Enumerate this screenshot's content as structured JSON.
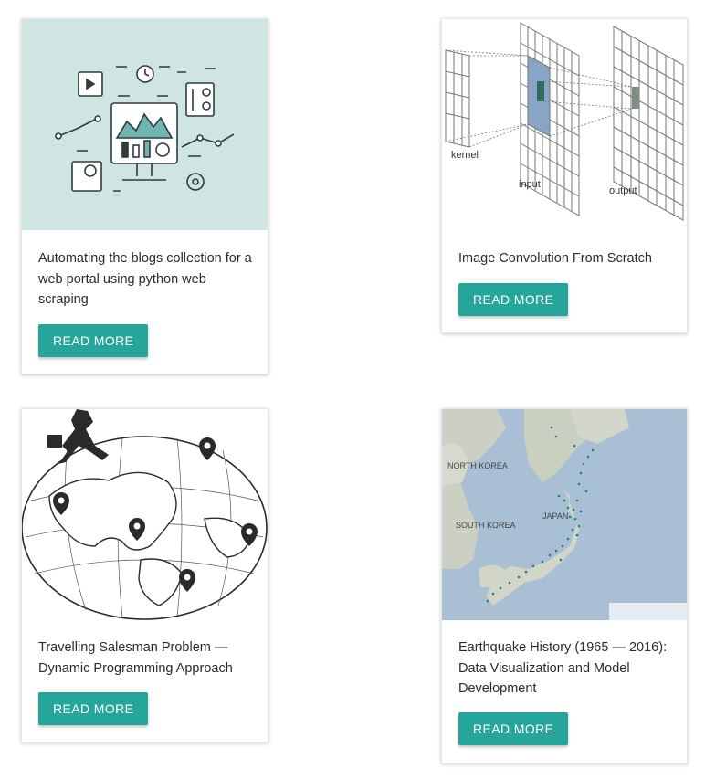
{
  "cards": [
    {
      "title": "Automating the blogs collection for a web portal using python web scraping",
      "button": "READ MORE",
      "image_icon": "dashboard-illustration"
    },
    {
      "title": "Image Convolution From Scratch",
      "button": "READ MORE",
      "image_icon": "convolution-diagram",
      "image_labels": {
        "kernel": "kernel",
        "input": "input",
        "output": "output"
      }
    },
    {
      "title": "Travelling Salesman Problem — Dynamic Programming Approach",
      "button": "READ MORE",
      "image_icon": "globe-route-illustration"
    },
    {
      "title": "Earthquake History (1965 — 2016): Data Visualization and Model Development",
      "button": "READ MORE",
      "image_icon": "japan-earthquake-map",
      "image_labels": {
        "north_korea": "NORTH KOREA",
        "south_korea": "SOUTH KOREA",
        "japan": "JAPAN"
      }
    }
  ],
  "colors": {
    "accent": "#26a69a",
    "image_bg_teal": "#cfe5e1",
    "map_sea": "#a9bfd3"
  }
}
